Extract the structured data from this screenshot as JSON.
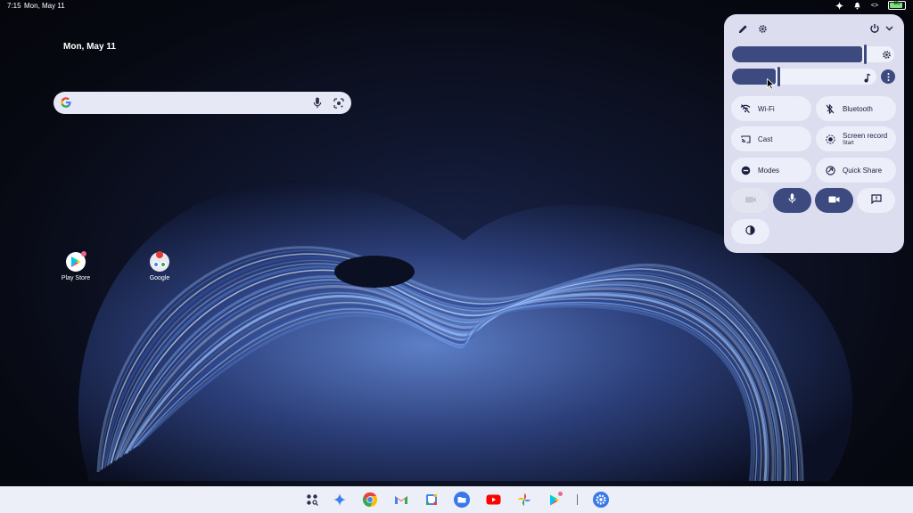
{
  "status_bar": {
    "time": "7:15",
    "date": "Mon, May 11",
    "battery_text": "85",
    "battery_level": 0.85,
    "icons": [
      "gemini-sparkle-icon",
      "do-not-disturb-bell-icon",
      "code-brackets-icon",
      "battery-icon"
    ]
  },
  "desktop": {
    "date": "Mon, May 11",
    "search": {
      "placeholder": "",
      "icons": [
        "google-g-icon",
        "mic-icon",
        "lens-icon"
      ]
    },
    "apps": [
      {
        "label": "Play Store",
        "icon": "play-store-icon"
      },
      {
        "label": "Google",
        "icon": "google-folder-icon",
        "badge_color": "#e53935"
      }
    ]
  },
  "quick_settings": {
    "top_icons": [
      "edit-pencil-icon",
      "settings-gear-icon",
      "power-icon",
      "chevron-down-icon"
    ],
    "brightness_level": 0.8,
    "volume_level": 0.3,
    "tiles": [
      {
        "label": "Wi-Fi",
        "sublabel": "",
        "icon": "wifi-off-icon"
      },
      {
        "label": "Bluetooth",
        "sublabel": "",
        "icon": "bluetooth-off-icon"
      },
      {
        "label": "Cast",
        "sublabel": "",
        "icon": "cast-icon"
      },
      {
        "label": "Screen record",
        "sublabel": "Start",
        "icon": "screen-record-icon"
      },
      {
        "label": "Modes",
        "sublabel": "",
        "icon": "modes-icon"
      },
      {
        "label": "Quick Share",
        "sublabel": "",
        "icon": "quick-share-icon"
      }
    ],
    "toggles": [
      "camera-off-icon",
      "microphone-icon",
      "video-camera-icon",
      "feedback-icon"
    ],
    "extra": [
      "contrast-icon"
    ]
  },
  "shelf": {
    "apps": [
      "launcher-icon",
      "gemini-icon",
      "chrome-icon",
      "gmail-icon",
      "calendar-icon",
      "files-icon",
      "youtube-icon",
      "photos-icon",
      "play-store-icon",
      "settings-icon"
    ]
  },
  "colors": {
    "accent": "#3c4a80",
    "panel": "#dcdef0",
    "tile": "#eceef9",
    "shelf": "#eceef8"
  }
}
